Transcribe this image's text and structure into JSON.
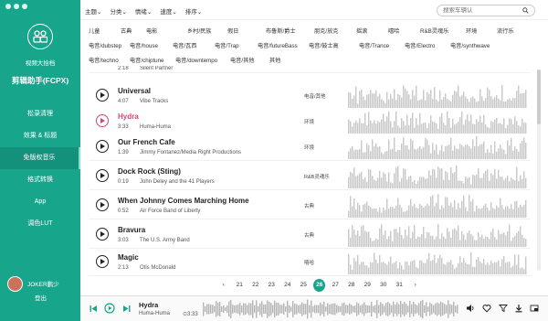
{
  "sidebar": {
    "subtitle": "视频大拾档",
    "app_name": "剪辑助手(FCPX)",
    "items": [
      {
        "label": "松录清理"
      },
      {
        "label": "效果 & 标题"
      },
      {
        "label": "免版权音乐"
      },
      {
        "label": "格式转换"
      },
      {
        "label": "App"
      },
      {
        "label": "调色LUT"
      }
    ],
    "user_name": "JOKER鹏少",
    "logout": "登出"
  },
  "filters": {
    "tabs": [
      "主题",
      "分类",
      "情绪",
      "速度",
      "排序"
    ],
    "search_placeholder": "搜索车辆认"
  },
  "genres": {
    "row1": [
      "儿童",
      "古典",
      "电影",
      "乡村/民族",
      "假日",
      "布鲁斯/爵士",
      "朋克/放克",
      "摇滚",
      "嘻哈",
      "R&B灵魂乐",
      "环境",
      "流行乐"
    ],
    "row2": [
      "电音/dubstep",
      "电音/house",
      "电音/瓦西",
      "电音/Trap",
      "电音/futureBass",
      "电音/鼓士高",
      "电音/Trance",
      "电音/Electro",
      "电音/synthwave"
    ],
    "row3": [
      "电音/techno",
      "电音/chiptune",
      "电音/downtempo",
      "电音/其他",
      "其他"
    ]
  },
  "tracks": [
    {
      "title": "",
      "duration": "2:18",
      "artist": "Silent Partner",
      "genre": ""
    },
    {
      "title": "Universal",
      "duration": "4:07",
      "artist": "Vibe Tracks",
      "genre": "电音/其他"
    },
    {
      "title": "Hydra",
      "duration": "3:33",
      "artist": "Huma-Huma",
      "genre": "环境"
    },
    {
      "title": "Our French Cafe",
      "duration": "1:39",
      "artist": "Jimmy Fontanez/Media Right Productions",
      "genre": "环境"
    },
    {
      "title": "Dock Rock (Sting)",
      "duration": "0:19",
      "artist": "John Deley and the 41 Players",
      "genre": "R&B灵魂乐"
    },
    {
      "title": "When Johnny Comes Marching Home",
      "duration": "0:52",
      "artist": "Air Force Band of Liberty",
      "genre": "古典"
    },
    {
      "title": "Bravura",
      "duration": "3:03",
      "artist": "The U.S. Army Band",
      "genre": "古典"
    },
    {
      "title": "Magic",
      "duration": "2:13",
      "artist": "Otis McDonald",
      "genre": "嘻哈"
    }
  ],
  "pagination": {
    "prev": "‹",
    "pages": [
      "21",
      "22",
      "23",
      "24",
      "25",
      "26",
      "27",
      "28",
      "29",
      "30",
      "31"
    ],
    "current": "26",
    "next": "›"
  },
  "player": {
    "title": "Hydra",
    "artist": "Huma-Huma",
    "time": "3:33"
  },
  "colors": {
    "sidebar": "#17a58c",
    "accent": "#d94277",
    "waveform": "#c8c8c8"
  }
}
